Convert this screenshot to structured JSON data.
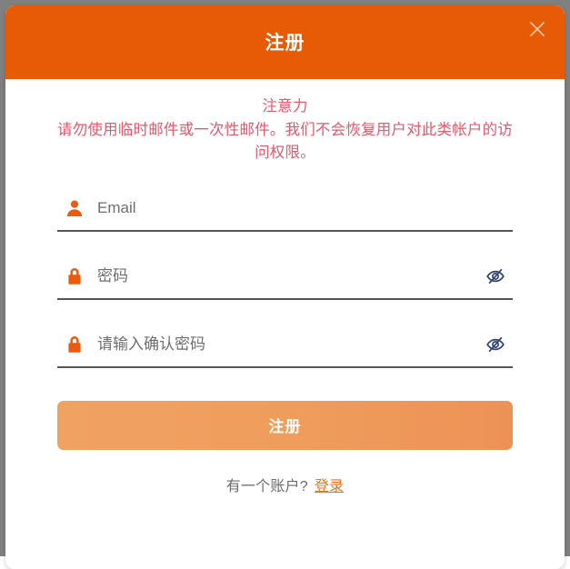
{
  "dialog": {
    "title": "注册",
    "close_label": "×",
    "accent_color": "#e85b06",
    "warning_color": "#e8576b",
    "link_color": "#e8751a"
  },
  "warning": {
    "heading": "注意力",
    "message": "请勿使用临时邮件或一次性邮件。我们不会恢复用户对此类帐户的访问权限。"
  },
  "form": {
    "email": {
      "placeholder": "Email",
      "value": "",
      "icon": "user-icon"
    },
    "password": {
      "placeholder": "密码",
      "value": "",
      "icon": "lock-icon",
      "toggle_icon": "eye-slash-icon"
    },
    "confirm_password": {
      "placeholder": "请输入确认密码",
      "value": "",
      "icon": "lock-icon",
      "toggle_icon": "eye-slash-icon"
    },
    "submit_label": "注册"
  },
  "footer": {
    "prompt": "有一个账户?",
    "link_label": "登录"
  }
}
